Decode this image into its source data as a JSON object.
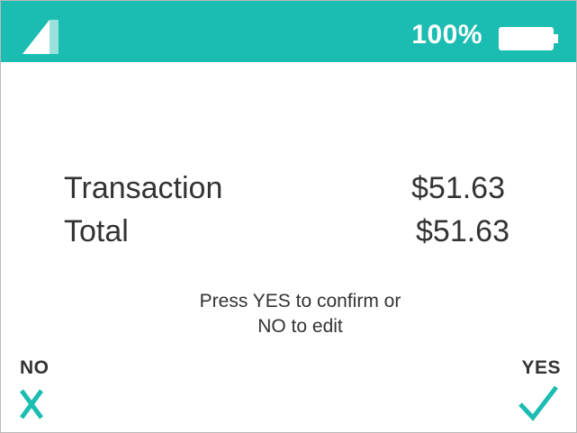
{
  "status_bar": {
    "battery_percent": "100%",
    "battery_level": 1.0,
    "signal_icon": "signal-strength-icon",
    "battery_icon": "battery-icon",
    "color": "#1bbcb1"
  },
  "summary": {
    "rows": [
      {
        "label": "Transaction",
        "value": "$51.63"
      },
      {
        "label": "Total",
        "value": "$51.63"
      }
    ]
  },
  "prompt": {
    "line1": "Press YES to confirm or",
    "line2": "NO to edit"
  },
  "actions": {
    "no_label": "NO",
    "no_icon": "x-icon",
    "yes_label": "YES",
    "yes_icon": "checkmark-icon",
    "accent_color": "#1bbcb1"
  }
}
